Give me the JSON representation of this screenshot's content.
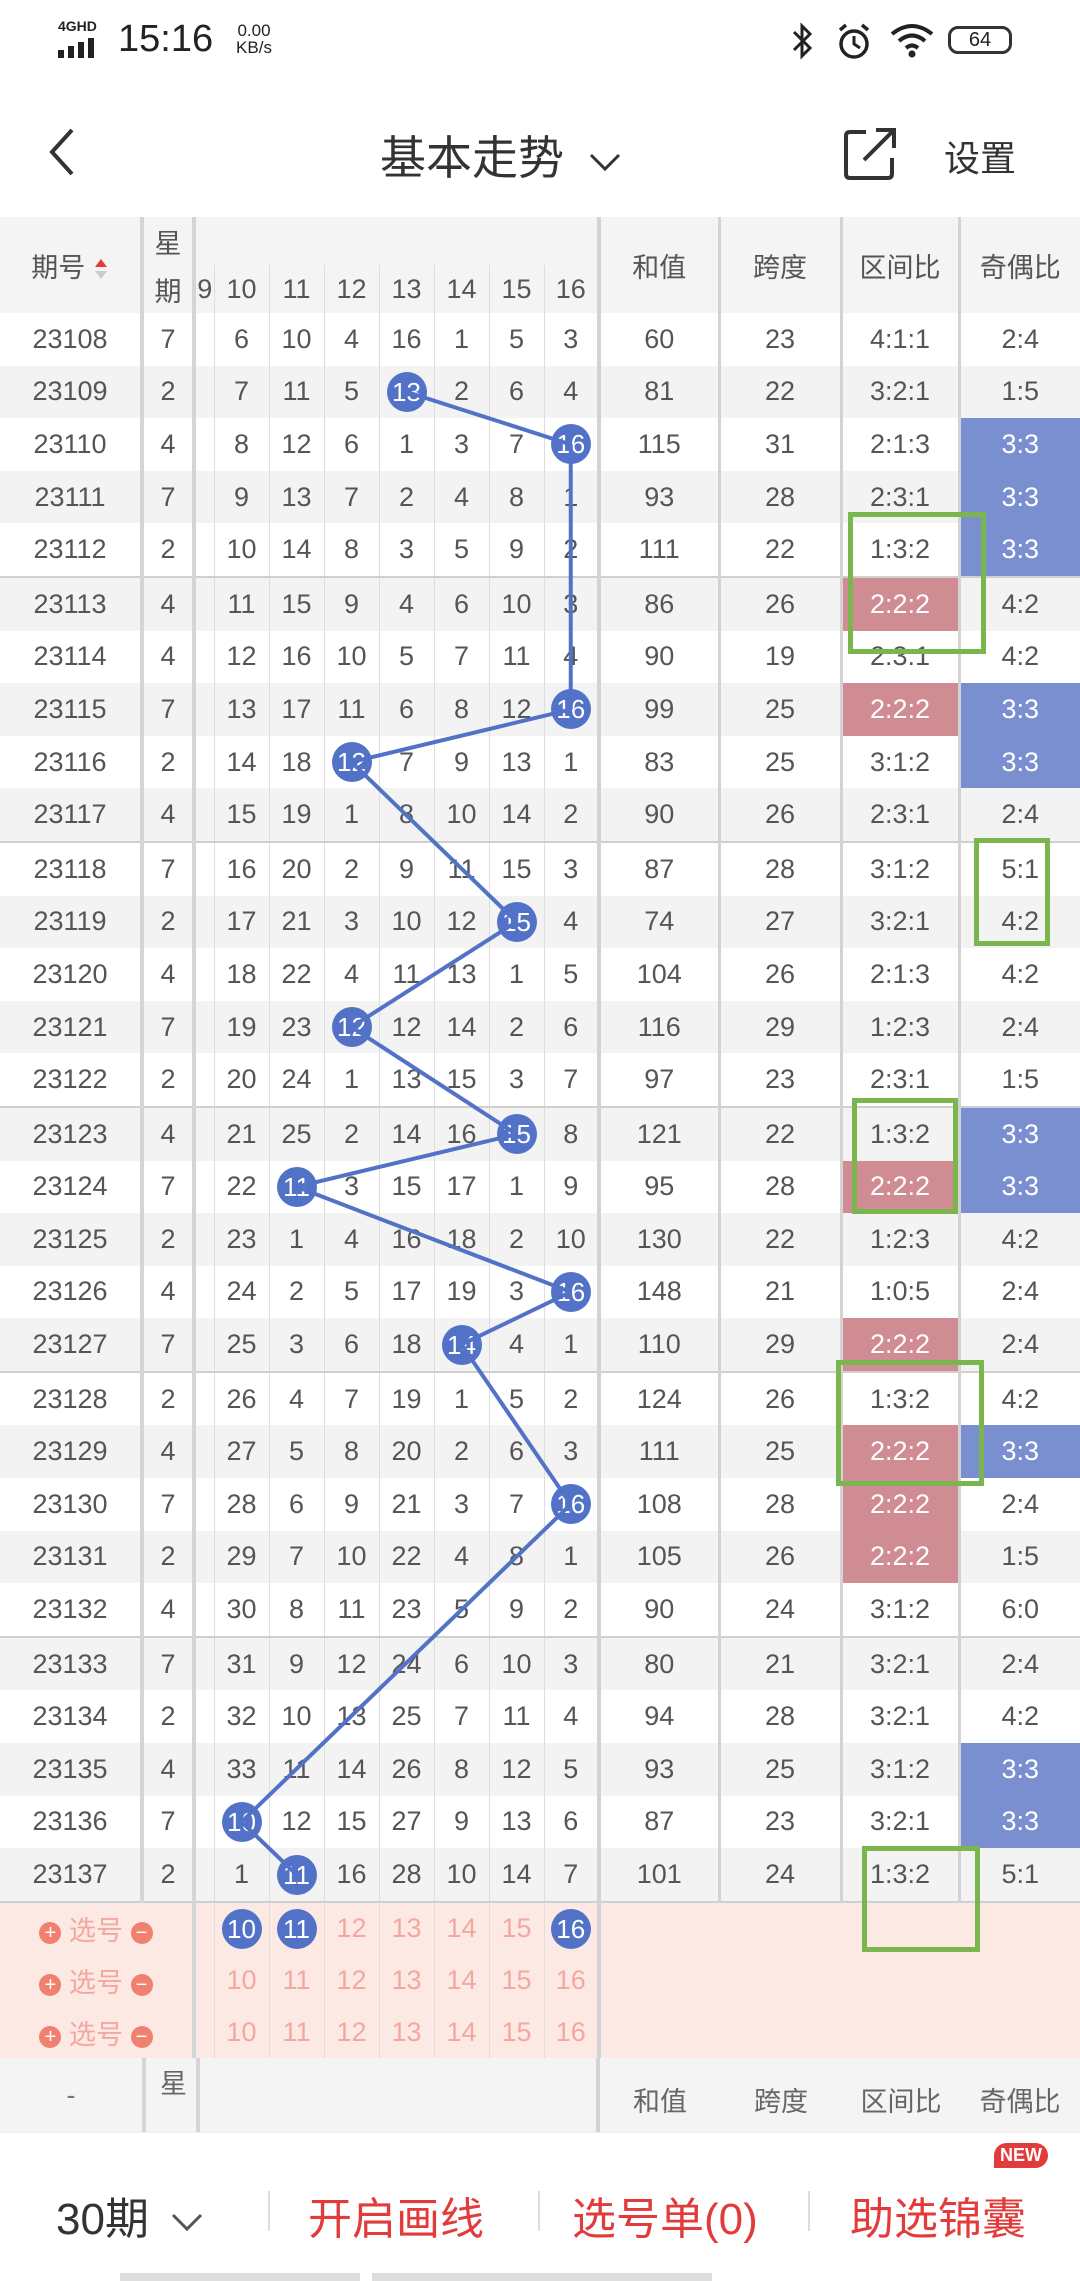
{
  "status": {
    "net": "4GHD",
    "time": "15:16",
    "speed": "0.00 KB/s",
    "battery": "64"
  },
  "header": {
    "title": "基本走势",
    "settings": "设置"
  },
  "table": {
    "col_headers": {
      "issue": "期号",
      "week_top": "星",
      "week_bottom": "期",
      "sum": "和值",
      "span": "跨度",
      "zone": "区间比",
      "oddeven": "奇偶比"
    },
    "number_headers": [
      "10",
      "11",
      "12",
      "13",
      "14",
      "15",
      "16"
    ],
    "rows": [
      {
        "issue": "23108",
        "week": "7",
        "nums": [
          "6",
          "10",
          "4",
          "16",
          "1",
          "5",
          "3"
        ],
        "sum": "60",
        "span": "23",
        "zone": "4:1:1",
        "oe": "2:4"
      },
      {
        "issue": "23109",
        "week": "2",
        "nums": [
          "7",
          "11",
          "5",
          "13",
          "2",
          "6",
          "4"
        ],
        "sum": "81",
        "span": "22",
        "zone": "3:2:1",
        "oe": "1:5"
      },
      {
        "issue": "23110",
        "week": "4",
        "nums": [
          "8",
          "12",
          "6",
          "1",
          "3",
          "7",
          "16"
        ],
        "sum": "115",
        "span": "31",
        "zone": "2:1:3",
        "oe": "3:3"
      },
      {
        "issue": "23111",
        "week": "7",
        "nums": [
          "9",
          "13",
          "7",
          "2",
          "4",
          "8",
          "1"
        ],
        "sum": "93",
        "span": "28",
        "zone": "2:3:1",
        "oe": "3:3"
      },
      {
        "issue": "23112",
        "week": "2",
        "nums": [
          "10",
          "14",
          "8",
          "3",
          "5",
          "9",
          "2"
        ],
        "sum": "111",
        "span": "22",
        "zone": "1:3:2",
        "oe": "3:3"
      },
      {
        "issue": "23113",
        "week": "4",
        "nums": [
          "11",
          "15",
          "9",
          "4",
          "6",
          "10",
          "3"
        ],
        "sum": "86",
        "span": "26",
        "zone": "2:2:2",
        "oe": "4:2"
      },
      {
        "issue": "23114",
        "week": "4",
        "nums": [
          "12",
          "16",
          "10",
          "5",
          "7",
          "11",
          "4"
        ],
        "sum": "90",
        "span": "19",
        "zone": "2:3:1",
        "oe": "4:2"
      },
      {
        "issue": "23115",
        "week": "7",
        "nums": [
          "13",
          "17",
          "11",
          "6",
          "8",
          "12",
          "16"
        ],
        "sum": "99",
        "span": "25",
        "zone": "2:2:2",
        "oe": "3:3"
      },
      {
        "issue": "23116",
        "week": "2",
        "nums": [
          "14",
          "18",
          "12",
          "7",
          "9",
          "13",
          "1"
        ],
        "sum": "83",
        "span": "25",
        "zone": "3:1:2",
        "oe": "3:3"
      },
      {
        "issue": "23117",
        "week": "4",
        "nums": [
          "15",
          "19",
          "1",
          "8",
          "10",
          "14",
          "2"
        ],
        "sum": "90",
        "span": "26",
        "zone": "2:3:1",
        "oe": "2:4"
      },
      {
        "issue": "23118",
        "week": "7",
        "nums": [
          "16",
          "20",
          "2",
          "9",
          "11",
          "15",
          "3"
        ],
        "sum": "87",
        "span": "28",
        "zone": "3:1:2",
        "oe": "5:1"
      },
      {
        "issue": "23119",
        "week": "2",
        "nums": [
          "17",
          "21",
          "3",
          "10",
          "12",
          "15",
          "4"
        ],
        "sum": "74",
        "span": "27",
        "zone": "3:2:1",
        "oe": "4:2"
      },
      {
        "issue": "23120",
        "week": "4",
        "nums": [
          "18",
          "22",
          "4",
          "11",
          "13",
          "1",
          "5"
        ],
        "sum": "104",
        "span": "26",
        "zone": "2:1:3",
        "oe": "4:2"
      },
      {
        "issue": "23121",
        "week": "7",
        "nums": [
          "19",
          "23",
          "12",
          "12",
          "14",
          "2",
          "6"
        ],
        "sum": "116",
        "span": "29",
        "zone": "1:2:3",
        "oe": "2:4"
      },
      {
        "issue": "23122",
        "week": "2",
        "nums": [
          "20",
          "24",
          "1",
          "13",
          "15",
          "3",
          "7"
        ],
        "sum": "97",
        "span": "23",
        "zone": "2:3:1",
        "oe": "1:5"
      },
      {
        "issue": "23123",
        "week": "4",
        "nums": [
          "21",
          "25",
          "2",
          "14",
          "16",
          "15",
          "8"
        ],
        "sum": "121",
        "span": "22",
        "zone": "1:3:2",
        "oe": "3:3"
      },
      {
        "issue": "23124",
        "week": "7",
        "nums": [
          "22",
          "11",
          "3",
          "15",
          "17",
          "1",
          "9"
        ],
        "sum": "95",
        "span": "28",
        "zone": "2:2:2",
        "oe": "3:3"
      },
      {
        "issue": "23125",
        "week": "2",
        "nums": [
          "23",
          "1",
          "4",
          "16",
          "18",
          "2",
          "10"
        ],
        "sum": "130",
        "span": "22",
        "zone": "1:2:3",
        "oe": "4:2"
      },
      {
        "issue": "23126",
        "week": "4",
        "nums": [
          "24",
          "2",
          "5",
          "17",
          "19",
          "3",
          "16"
        ],
        "sum": "148",
        "span": "21",
        "zone": "1:0:5",
        "oe": "2:4"
      },
      {
        "issue": "23127",
        "week": "7",
        "nums": [
          "25",
          "3",
          "6",
          "18",
          "14",
          "4",
          "1"
        ],
        "sum": "110",
        "span": "29",
        "zone": "2:2:2",
        "oe": "2:4"
      },
      {
        "issue": "23128",
        "week": "2",
        "nums": [
          "26",
          "4",
          "7",
          "19",
          "1",
          "5",
          "2"
        ],
        "sum": "124",
        "span": "26",
        "zone": "1:3:2",
        "oe": "4:2"
      },
      {
        "issue": "23129",
        "week": "4",
        "nums": [
          "27",
          "5",
          "8",
          "20",
          "2",
          "6",
          "3"
        ],
        "sum": "111",
        "span": "25",
        "zone": "2:2:2",
        "oe": "3:3"
      },
      {
        "issue": "23130",
        "week": "7",
        "nums": [
          "28",
          "6",
          "9",
          "21",
          "3",
          "7",
          "16"
        ],
        "sum": "108",
        "span": "28",
        "zone": "2:2:2",
        "oe": "2:4"
      },
      {
        "issue": "23131",
        "week": "2",
        "nums": [
          "29",
          "7",
          "10",
          "22",
          "4",
          "8",
          "1"
        ],
        "sum": "105",
        "span": "26",
        "zone": "2:2:2",
        "oe": "1:5"
      },
      {
        "issue": "23132",
        "week": "4",
        "nums": [
          "30",
          "8",
          "11",
          "23",
          "5",
          "9",
          "2"
        ],
        "sum": "90",
        "span": "24",
        "zone": "3:1:2",
        "oe": "6:0"
      },
      {
        "issue": "23133",
        "week": "7",
        "nums": [
          "31",
          "9",
          "12",
          "24",
          "6",
          "10",
          "3"
        ],
        "sum": "80",
        "span": "21",
        "zone": "3:2:1",
        "oe": "2:4"
      },
      {
        "issue": "23134",
        "week": "2",
        "nums": [
          "32",
          "10",
          "13",
          "25",
          "7",
          "11",
          "4"
        ],
        "sum": "94",
        "span": "28",
        "zone": "3:2:1",
        "oe": "4:2"
      },
      {
        "issue": "23135",
        "week": "4",
        "nums": [
          "33",
          "11",
          "14",
          "26",
          "8",
          "12",
          "5"
        ],
        "sum": "93",
        "span": "25",
        "zone": "3:1:2",
        "oe": "3:3"
      },
      {
        "issue": "23136",
        "week": "7",
        "nums": [
          "10",
          "12",
          "15",
          "27",
          "9",
          "13",
          "6"
        ],
        "sum": "87",
        "span": "23",
        "zone": "3:2:1",
        "oe": "3:3"
      },
      {
        "issue": "23137",
        "week": "2",
        "nums": [
          "1",
          "11",
          "16",
          "28",
          "10",
          "14",
          "7"
        ],
        "sum": "101",
        "span": "24",
        "zone": "1:3:2",
        "oe": "5:1"
      }
    ],
    "select_label": "选号",
    "select_rows": [
      [
        "10",
        "11",
        "12",
        "13",
        "14",
        "15",
        "16"
      ],
      [
        "10",
        "11",
        "12",
        "13",
        "14",
        "15",
        "16"
      ],
      [
        "10",
        "11",
        "12",
        "13",
        "14",
        "15",
        "16"
      ]
    ],
    "footer_issue": "-"
  },
  "bottom": {
    "period": "30期",
    "draw_line": "开启画线",
    "pick_list": "选号单(0)",
    "helper": "助选锦囊",
    "badge": "NEW"
  },
  "colors": {
    "ball": "#5272c8",
    "pink": "#cf8c93",
    "blue": "#7a8fcf",
    "green_box": "#7ab54e",
    "red": "#e23b3b"
  }
}
